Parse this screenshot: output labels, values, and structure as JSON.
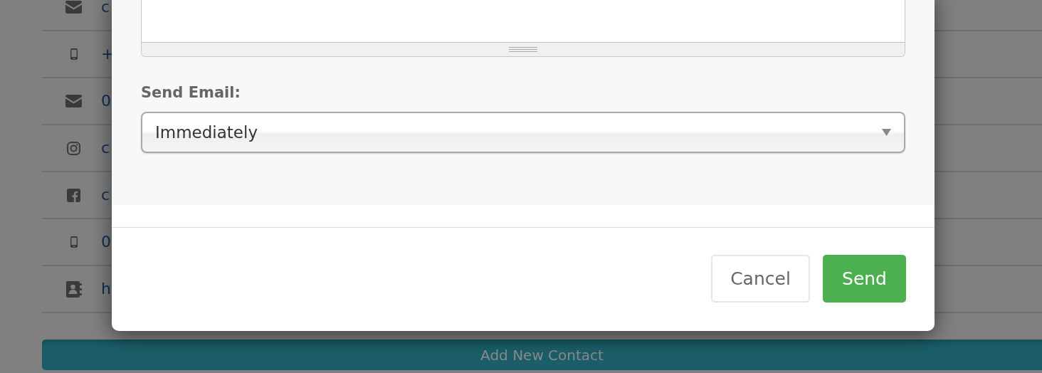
{
  "contacts": [
    {
      "kind": "email",
      "text": "c"
    },
    {
      "kind": "mobile",
      "text": "+"
    },
    {
      "kind": "email",
      "text": "0"
    },
    {
      "kind": "instagram",
      "text": "c"
    },
    {
      "kind": "facebook",
      "text": "c"
    },
    {
      "kind": "mobile",
      "text": "0"
    },
    {
      "kind": "contact",
      "text": "h"
    }
  ],
  "add_button": "Add New Contact",
  "modal": {
    "field_label": "Send Email:",
    "send_email": {
      "value": "Immediately"
    },
    "buttons": [
      {
        "label": "Cancel",
        "kind": "default"
      },
      {
        "label": "Send",
        "kind": "primary"
      }
    ]
  }
}
